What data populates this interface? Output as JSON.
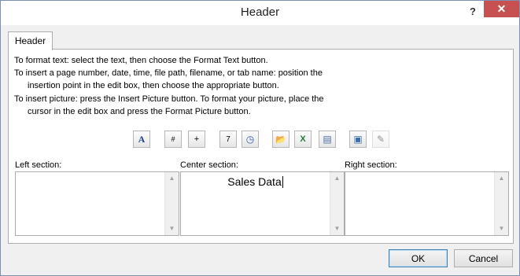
{
  "window": {
    "title": "Header",
    "help_glyph": "?",
    "close_glyph": "✕"
  },
  "tab": {
    "label": "Header"
  },
  "instructions": [
    "To format text:  select the text, then choose the Format Text button.",
    "To insert a page number, date, time, file path, filename, or tab name:  position the",
    "insertion point in the edit box, then choose the appropriate button.",
    "To insert picture: press the Insert Picture button.  To format your picture, place the",
    "cursor in the edit box and press the Format Picture button."
  ],
  "toolbar": [
    {
      "name": "format-text-icon",
      "glyph": "A"
    },
    {
      "name": "insert-page-number-icon",
      "glyph": "#"
    },
    {
      "name": "insert-number-of-pages-icon",
      "glyph": "+"
    },
    {
      "name": "insert-date-icon",
      "glyph": "7"
    },
    {
      "name": "insert-time-icon",
      "glyph": "◷"
    },
    {
      "name": "insert-file-path-icon",
      "glyph": "📂"
    },
    {
      "name": "insert-file-name-icon",
      "glyph": "X"
    },
    {
      "name": "insert-sheet-name-icon",
      "glyph": "▤"
    },
    {
      "name": "insert-picture-icon",
      "glyph": "▣"
    },
    {
      "name": "format-picture-icon",
      "glyph": "✎"
    }
  ],
  "sections": {
    "left": {
      "label": "Left section:",
      "content": ""
    },
    "center": {
      "label": "Center section:",
      "content": "Sales Data"
    },
    "right": {
      "label": "Right section:",
      "content": ""
    }
  },
  "buttons": {
    "ok": "OK",
    "cancel": "Cancel"
  }
}
